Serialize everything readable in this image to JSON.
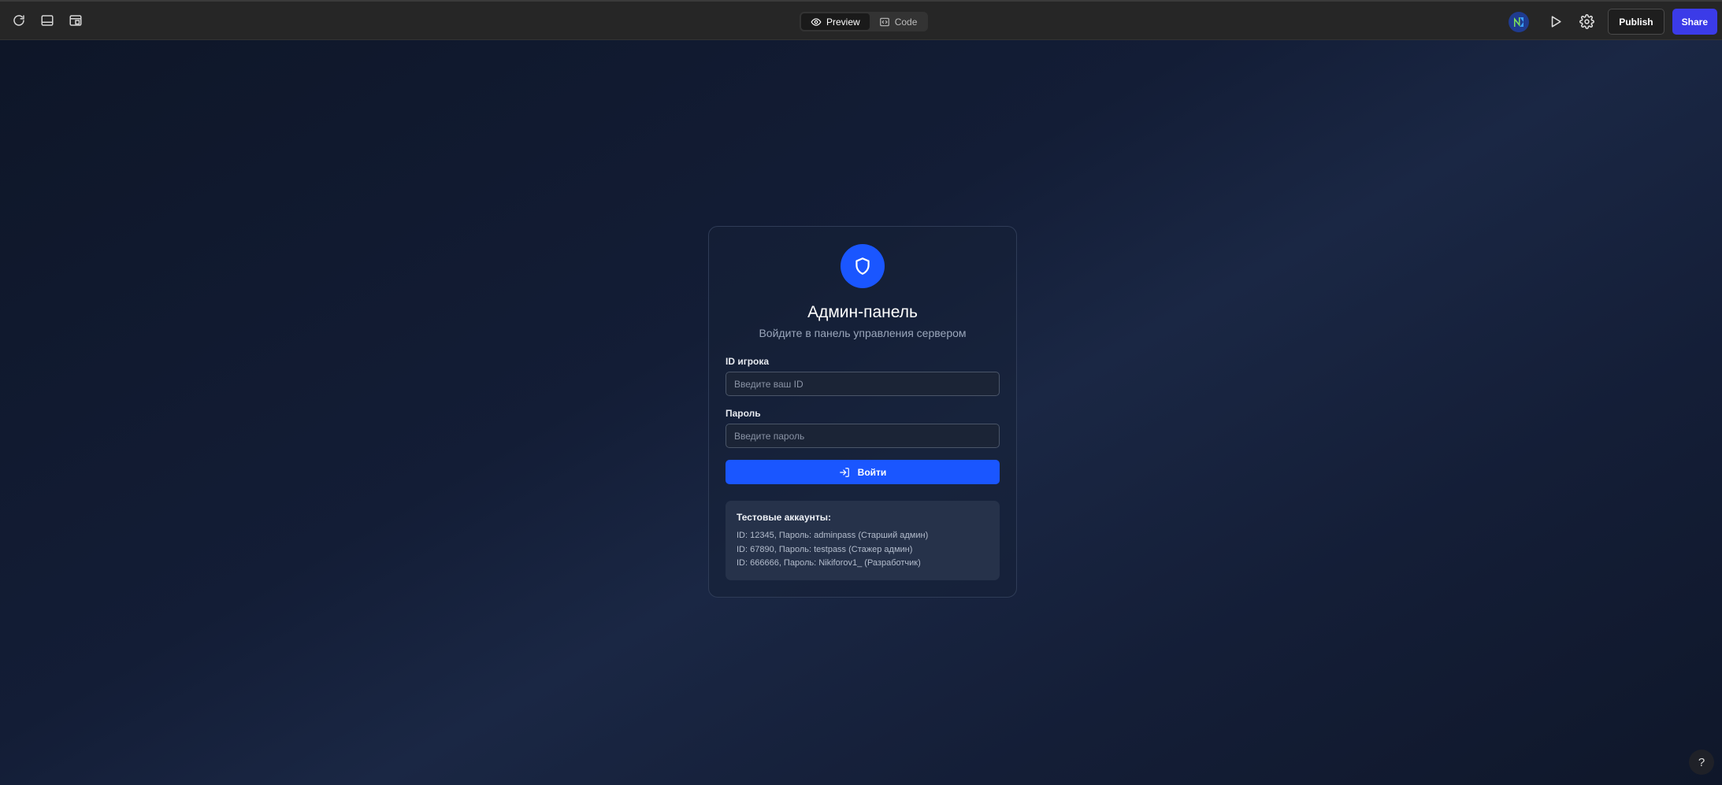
{
  "toolbar": {
    "left_icons": [
      "refresh-icon",
      "panel-bottom-icon",
      "layout-icon"
    ],
    "tabs": [
      {
        "label": "Preview",
        "icon": "eye-icon",
        "active": true
      },
      {
        "label": "Code",
        "icon": "code-icon",
        "active": false
      }
    ],
    "right_icons": [
      "logo-n-icon",
      "play-icon",
      "gear-icon"
    ],
    "publish_label": "Publish",
    "share_label": "Share",
    "share_color": "#3b3be8"
  },
  "login": {
    "icon": "shield-icon",
    "title": "Админ-панель",
    "subtitle": "Войдите в панель управления сервером",
    "id_label": "ID игрока",
    "id_placeholder": "Введите ваш ID",
    "id_value": "",
    "password_label": "Пароль",
    "password_placeholder": "Введите пароль",
    "password_value": "",
    "submit_label": "Войти",
    "submit_icon": "login-arrow-icon",
    "accent_color": "#1a56ff"
  },
  "test_accounts": {
    "title": "Тестовые аккаунты:",
    "lines": [
      "ID: 12345, Пароль: adminpass (Старший админ)",
      "ID: 67890, Пароль: testpass (Стажер админ)",
      "ID: 666666, Пароль: Nikiforov1_ (Разработчик)"
    ]
  },
  "help_label": "?"
}
